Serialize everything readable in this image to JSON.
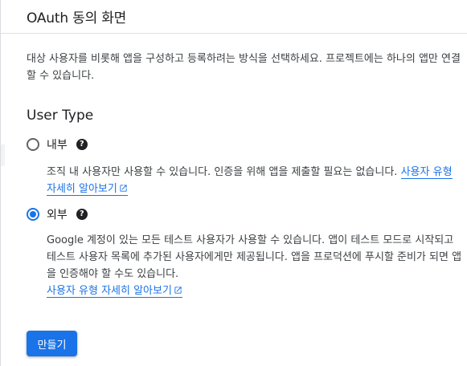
{
  "header": {
    "title": "OAuth 동의 화면"
  },
  "intro": "대상 사용자를 비롯해 앱을 구성하고 등록하려는 방식을 선택하세요. 프로젝트에는 하나의 앱만 연결할 수 있습니다.",
  "user_type": {
    "heading": "User Type",
    "options": [
      {
        "label": "내부",
        "selected": false,
        "description": "조직 내 사용자만 사용할 수 있습니다. 인증을 위해 앱을 제출할 필요는 없습니다.",
        "link_text": "사용자 유형 자세히 알아보기"
      },
      {
        "label": "외부",
        "selected": true,
        "description": "Google 계정이 있는 모든 테스트 사용자가 사용할 수 있습니다. 앱이 테스트 모드로 시작되고 테스트 사용자 목록에 추가된 사용자에게만 제공됩니다. 앱을 프로덕션에 푸시할 준비가 되면 앱을 인증해야 할 수도 있습니다.",
        "link_text": "사용자 유형 자세히 알아보기"
      }
    ]
  },
  "create_button": {
    "label": "만들기"
  },
  "colors": {
    "accent": "#1a73e8",
    "text": "#202124",
    "secondary_text": "#3c4043"
  },
  "icons": {
    "help": "help-circle-icon",
    "external": "open-in-new-icon"
  }
}
